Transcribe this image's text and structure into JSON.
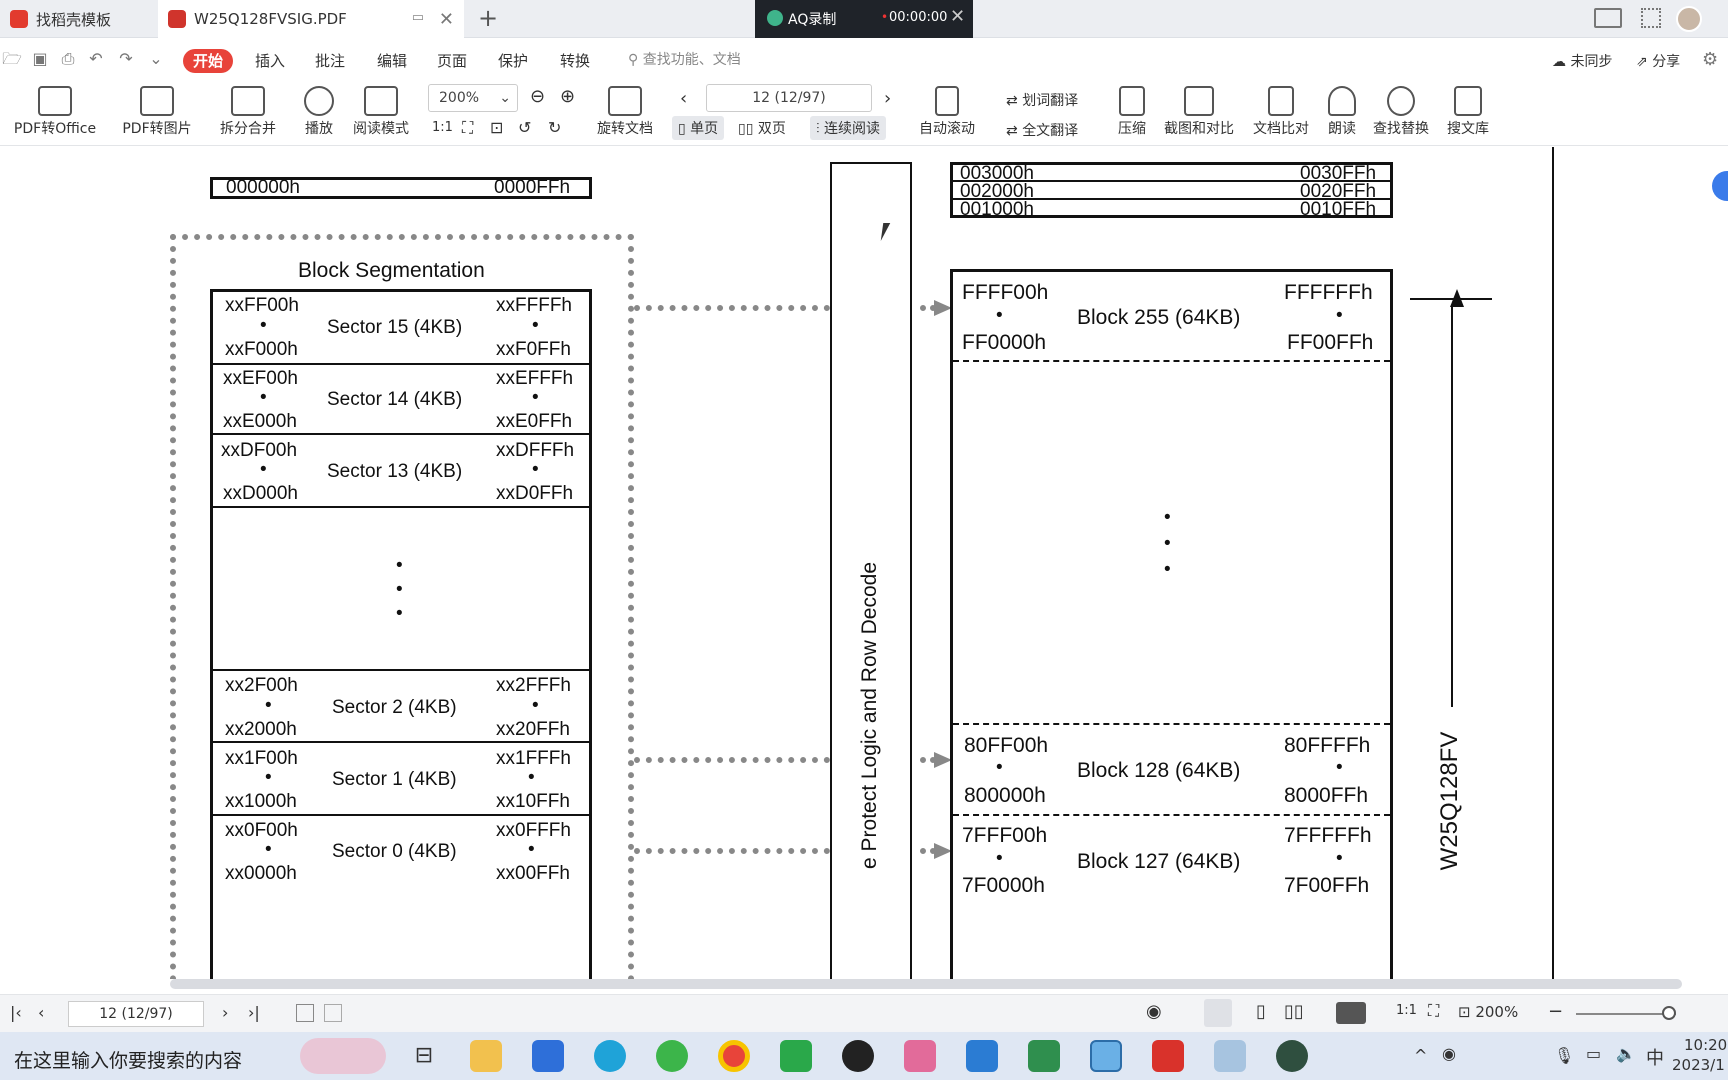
{
  "tabs": [
    {
      "label": "找稻壳模板"
    },
    {
      "label": "W25Q128FVSIG.PDF"
    }
  ],
  "menu": [
    "开始",
    "插入",
    "批注",
    "编辑",
    "页面",
    "保护",
    "转换"
  ],
  "search_placeholder": "查找功能、文档",
  "sync": {
    "label": "未同步"
  },
  "share": {
    "label": "分享"
  },
  "ribbon": {
    "pdf_to_office": "PDF转Office",
    "pdf_to_image": "PDF转图片",
    "split_merge": "拆分合并",
    "play": "播放",
    "read_mode": "阅读模式",
    "zoom": "200%",
    "rotate_doc": "旋转文档",
    "page_indicator": "12 (12/97)",
    "single": "单页",
    "double": "双页",
    "continuous": "连续阅读",
    "auto_scroll": "自动滚动",
    "word_translate": "划词翻译",
    "full_translate": "全文翻译",
    "compress": "压缩",
    "screenshot_compare": "截图和对比",
    "doc_compare": "文档比对",
    "read_aloud": "朗读",
    "find_replace": "查找替换",
    "search_library": "搜文库"
  },
  "recording": {
    "title": "AQ录制",
    "time": "00:00:00"
  },
  "doc": {
    "top_left": {
      "start": "000000h",
      "end": "0000FFh"
    },
    "top_right": [
      {
        "start": "003000h",
        "end": "0030FFh"
      },
      {
        "start": "002000h",
        "end": "0020FFh"
      },
      {
        "start": "001000h",
        "end": "0010FFh"
      }
    ],
    "block_seg_title": "Block Segmentation",
    "sectors": [
      {
        "a": "xxFF00h",
        "b": "xxFFFFh",
        "c": "xxF000h",
        "d": "xxF0FFh",
        "name": "Sector 15 (4KB)"
      },
      {
        "a": "xxEF00h",
        "b": "xxEFFFh",
        "c": "xxE000h",
        "d": "xxE0FFh",
        "name": "Sector 14 (4KB)"
      },
      {
        "a": "xxDF00h",
        "b": "xxDFFFh",
        "c": "xxD000h",
        "d": "xxD0FFh",
        "name": "Sector 13 (4KB)"
      },
      {
        "a": "xx2F00h",
        "b": "xx2FFFh",
        "c": "xx2000h",
        "d": "xx20FFh",
        "name": "Sector 2 (4KB)"
      },
      {
        "a": "xx1F00h",
        "b": "xx1FFFh",
        "c": "xx1000h",
        "d": "xx10FFh",
        "name": "Sector 1 (4KB)"
      },
      {
        "a": "xx0F00h",
        "b": "xx0FFFh",
        "c": "xx0000h",
        "d": "xx00FFh",
        "name": "Sector 0 (4KB)"
      }
    ],
    "blocks": [
      {
        "a": "FFFF00h",
        "b": "FFFFFFh",
        "c": "FF0000h",
        "d": "FF00FFh",
        "name": "Block 255 (64KB)"
      },
      {
        "a": "80FF00h",
        "b": "80FFFFh",
        "c": "800000h",
        "d": "8000FFh",
        "name": "Block 128 (64KB)"
      },
      {
        "a": "7FFF00h",
        "b": "7FFFFFh",
        "c": "7F0000h",
        "d": "7F00FFh",
        "name": "Block 127 (64KB)"
      }
    ],
    "vertical_label": "e Protect Logic and Row Decode",
    "chip_label": "W25Q128FV",
    "dot": "•"
  },
  "status": {
    "page": "12 (12/97)",
    "zoom": "200%"
  },
  "taskbar": {
    "search_placeholder": "在这里输入你要搜索的内容",
    "time": "10:20",
    "date": "2023/1",
    "ime": "中"
  }
}
